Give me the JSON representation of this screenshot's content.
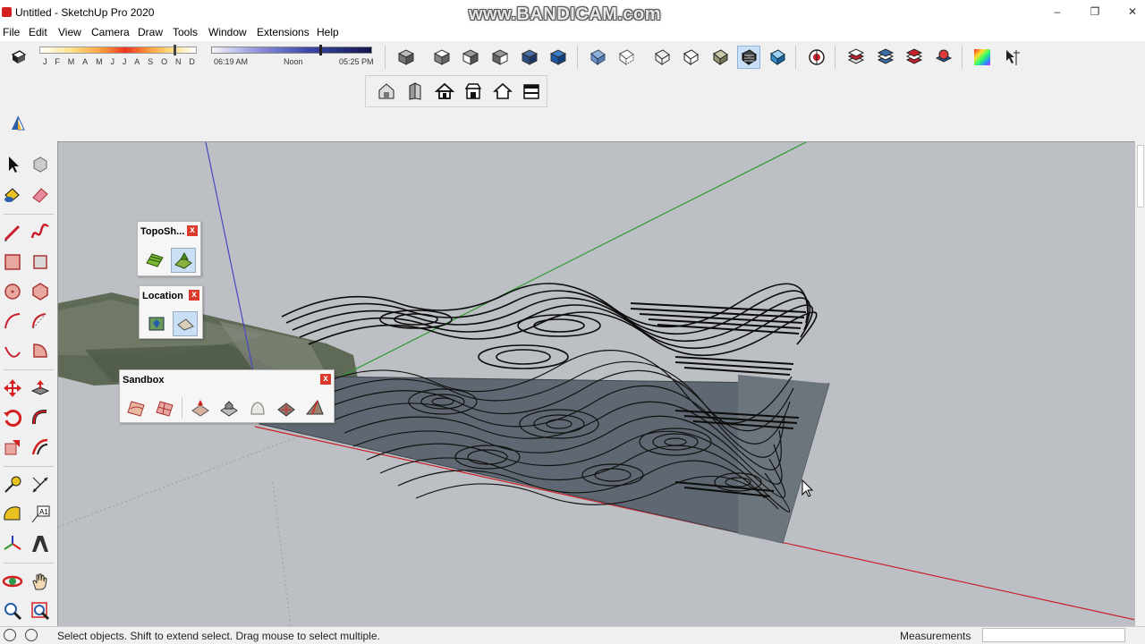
{
  "window": {
    "title": "Untitled - SketchUp Pro 2020",
    "watermark": "www.BANDICAM.com",
    "controls": [
      "minimize",
      "restore",
      "close"
    ]
  },
  "menu": [
    "File",
    "Edit",
    "View",
    "Camera",
    "Draw",
    "Tools",
    "Window",
    "Extensions",
    "Help"
  ],
  "shadows": {
    "months": [
      "J",
      "F",
      "M",
      "A",
      "M",
      "J",
      "J",
      "A",
      "S",
      "O",
      "N",
      "D"
    ],
    "time_start": "06:19 AM",
    "time_mid": "Noon",
    "time_end": "05:25 PM",
    "month_position": 0.88,
    "time_position": 0.67
  },
  "toolbars": {
    "views": [
      "iso-view-icon",
      "top-view-icon",
      "front-view-icon",
      "right-view-icon",
      "back-view-icon",
      "left-view-icon"
    ],
    "styles": [
      "xray-style-icon",
      "back-edges-style-icon",
      "wireframe-style-icon",
      "hidden-line-style-icon",
      "shaded-style-icon",
      "shaded-texture-style-icon",
      "monochrome-style-icon"
    ],
    "active_style": "shaded-texture-style-icon",
    "warehouse": [
      "extension-warehouse-icon"
    ],
    "layers": [
      "layer-manager-icon",
      "layer-stack-icon",
      "layer-red-icon",
      "layer-globe-icon"
    ],
    "color": [
      "color-picker-icon"
    ],
    "misc": [
      "pointer-axes-icon"
    ],
    "floating": [
      "house-3d-icon",
      "wall-icon",
      "house-icon",
      "roof-icon",
      "house-outline-icon",
      "building-icon"
    ],
    "section": [
      "section-plane-icon"
    ]
  },
  "palettes": {
    "topo": {
      "title": "TopoSh...",
      "close": "x"
    },
    "location": {
      "title": "Location",
      "close": "x"
    },
    "sandbox": {
      "title": "Sandbox",
      "close": "x"
    }
  },
  "status": {
    "hint": "Select objects. Shift to extend select. Drag mouse to select multiple.",
    "measurements_label": "Measurements",
    "measurements_value": ""
  },
  "colors": {
    "viewport_bg": "#bcbfc4",
    "red_axis": "#c8202a",
    "green_axis": "#2f9a2f",
    "blue_axis": "#3a3ab4",
    "terrain_face": "#5f6872",
    "contour": "#111111",
    "accent_close": "#d93a2b"
  }
}
